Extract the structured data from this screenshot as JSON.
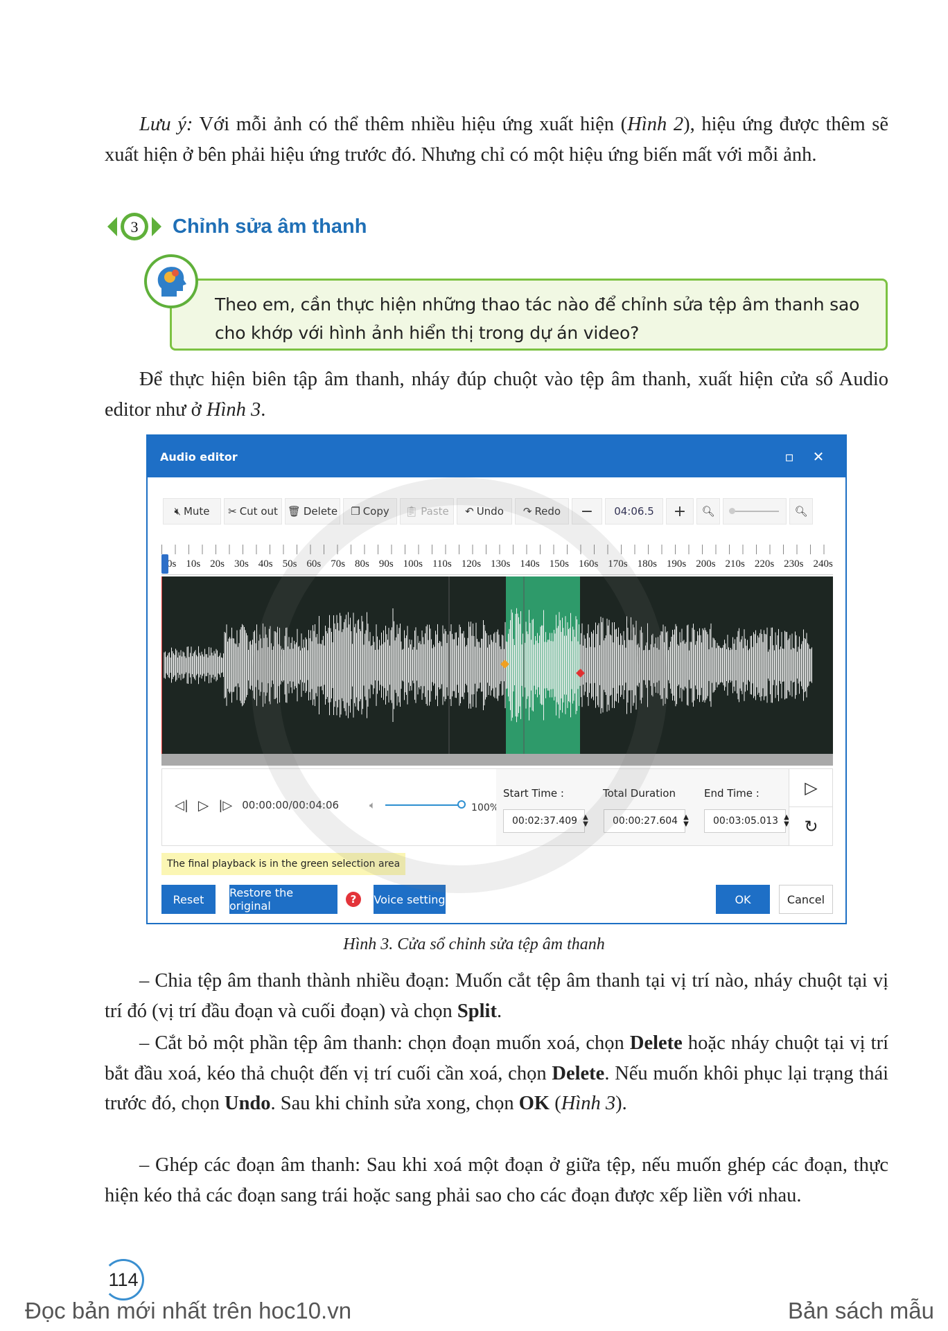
{
  "note_paragraph": {
    "lead": "Lưu ý:",
    "text1": " Với mỗi ảnh có thể thêm nhiều hiệu ứng xuất hiện (",
    "ref": "Hình 2",
    "text2": "), hiệu ứng được thêm sẽ xuất hiện ở bên phải hiệu ứng trước đó. Nhưng chỉ có một hiệu ứng biến mất với mỗi ảnh."
  },
  "section": {
    "number": "3",
    "title": "Chỉnh sửa âm thanh"
  },
  "question": "Theo em, cần thực hiện những thao tác nào để chỉnh sửa tệp âm thanh sao cho khớp với hình ảnh hiển thị trong dự án video?",
  "intro": {
    "text": "Để thực hiện biên tập âm thanh, nháy đúp chuột vào tệp âm thanh, xuất hiện cửa sổ Audio editor như ở ",
    "ref": "Hình 3",
    "end": "."
  },
  "dialog": {
    "title": "Audio editor",
    "toolbar": {
      "mute": "Mute",
      "cut": "Cut out",
      "delete": "Delete",
      "copy": "Copy",
      "paste": "Paste",
      "undo": "Undo",
      "redo": "Redo",
      "minus": "−",
      "zoom_value": "04:06.5",
      "plus": "+"
    },
    "ruler": [
      "0s",
      "10s",
      "20s",
      "30s",
      "40s",
      "50s",
      "60s",
      "70s",
      "80s",
      "90s",
      "100s",
      "110s",
      "120s",
      "130s",
      "140s",
      "150s",
      "160s",
      "170s",
      "180s",
      "190s",
      "200s",
      "210s",
      "220s",
      "230s",
      "240s"
    ],
    "playback_time": "00:00:00/00:04:06",
    "volume": "100%",
    "volume_level": 1.0,
    "start_label": "Start Time :",
    "start_value": "00:02:37.409",
    "duration_label": "Total Duration",
    "duration_value": "00:00:27.604",
    "end_label": "End Time :",
    "end_value": "00:03:05.013",
    "note": "The final playback is in the green selection area",
    "buttons": {
      "reset": "Reset",
      "restore": "Restore the original",
      "voice": "Voice setting",
      "ok": "OK",
      "cancel": "Cancel"
    },
    "colors": {
      "accent": "#1e6fc6",
      "selection": "#2e9a6a",
      "waveform_bg": "#1d2622"
    }
  },
  "caption": "Hình 3. Cửa sổ chỉnh sửa tệp âm thanh",
  "bullets": [
    {
      "t1": "– Chia tệp âm thanh thành nhiều đoạn: Muốn cắt tệp âm thanh tại vị trí nào, nháy chuột tại vị trí đó (vị trí đầu đoạn và cuối đoạn) và chọn ",
      "b1": "Split",
      "t2": "."
    },
    {
      "t1": "– Cắt bỏ một phần tệp âm thanh: chọn đoạn muốn xoá, chọn ",
      "b1": "Delete",
      "t2": " hoặc nháy chuột tại vị trí bắt đầu xoá, kéo thả chuột đến vị trí cuối cần xoá, chọn ",
      "b2": "Delete",
      "t3": ". Nếu muốn khôi phục lại trạng thái trước đó, chọn ",
      "b3": "Undo",
      "t4": ". Sau khi chỉnh sửa xong, chọn ",
      "b4": "OK",
      "t5": " (",
      "i1": "Hình 3",
      "t6": ")."
    },
    {
      "t1": "– Ghép các đoạn âm thanh: Sau khi xoá một đoạn ở giữa tệp, nếu muốn ghép các đoạn, thực hiện kéo thả các đoạn sang trái hoặc sang phải sao cho các đoạn được xếp liền với nhau."
    }
  ],
  "page_number": "114",
  "footer": {
    "left": "Đọc bản mới nhất trên hoc10.vn",
    "right": "Bản sách mẫu"
  }
}
